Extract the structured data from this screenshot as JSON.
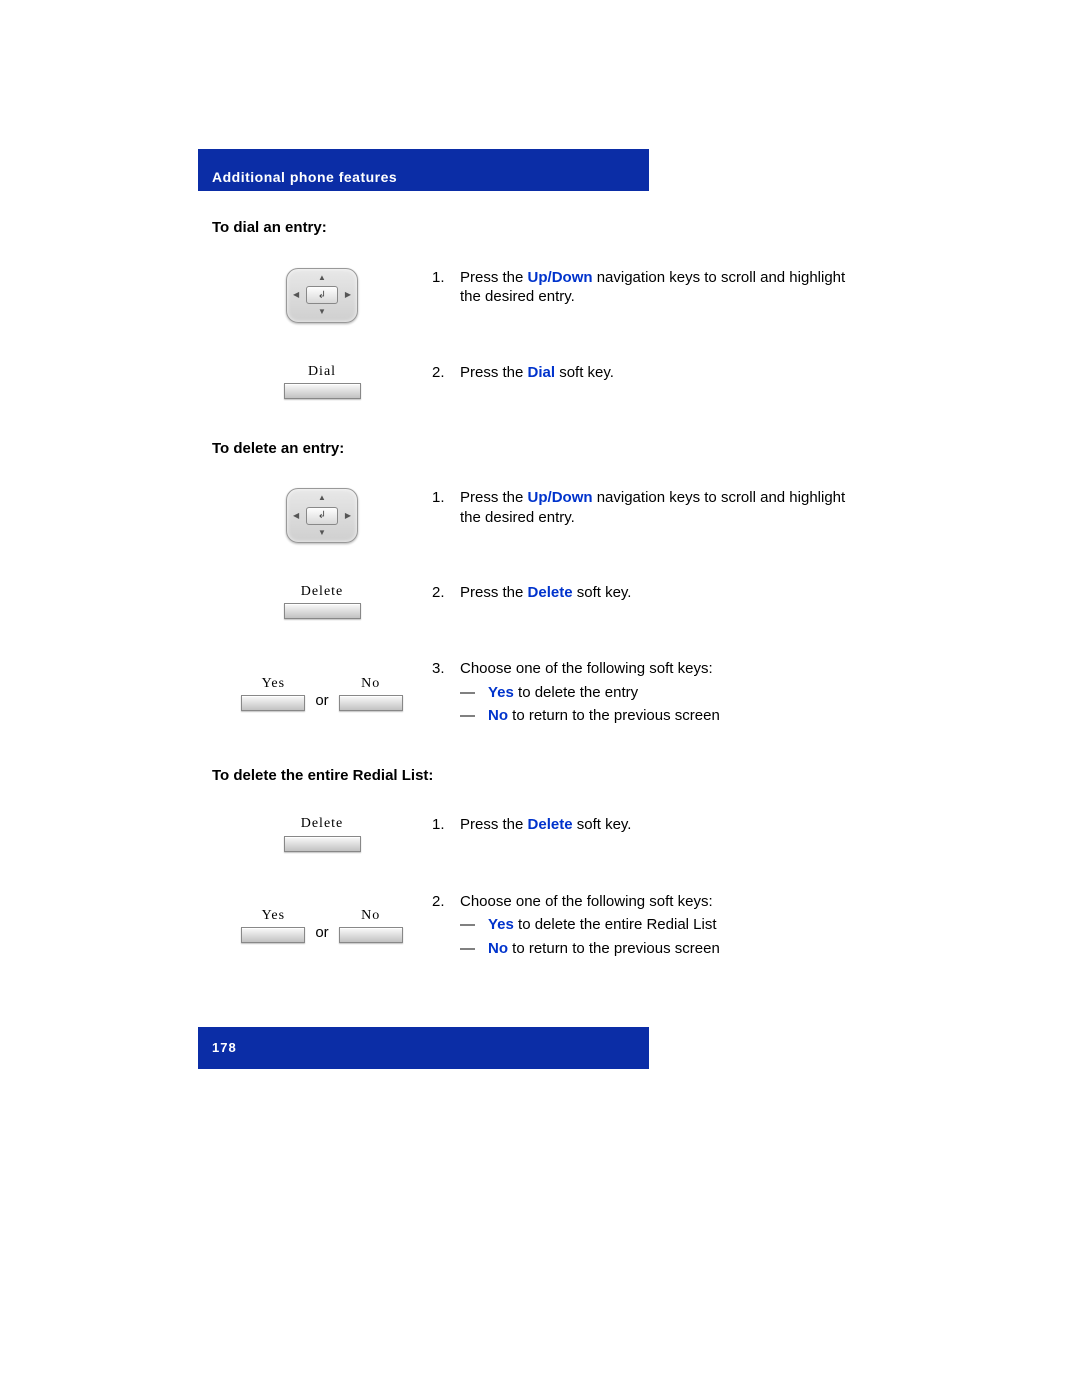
{
  "header": {
    "title": "Additional phone features"
  },
  "sections": {
    "dial": {
      "heading": "To dial an entry:",
      "step1": {
        "num": "1.",
        "pre": "Press the ",
        "key": "Up/Down",
        "post": " navigation keys to scroll and highlight the desired entry."
      },
      "step2": {
        "num": "2.",
        "pre": "Press the ",
        "key": "Dial",
        "post": " soft key."
      },
      "softkey": "Dial"
    },
    "delete": {
      "heading": "To delete an entry:",
      "step1": {
        "num": "1.",
        "pre": "Press the ",
        "key": "Up/Down",
        "post": " navigation keys to scroll and highlight the desired entry."
      },
      "step2": {
        "num": "2.",
        "pre": "Press the ",
        "key": "Delete",
        "post": " soft key."
      },
      "softkey": "Delete",
      "step3": {
        "num": "3.",
        "text": "Choose one of the following soft keys:"
      },
      "opt1": {
        "dash": "—",
        "key": "Yes",
        "post": " to delete the entry"
      },
      "opt2": {
        "dash": "—",
        "key": "No",
        "post": " to return to the previous screen"
      },
      "yesLabel": "Yes",
      "noLabel": "No",
      "or": "or"
    },
    "deleteAll": {
      "heading": "To delete the entire Redial List:",
      "step1": {
        "num": "1.",
        "pre": "Press the ",
        "key": "Delete",
        "post": " soft key."
      },
      "softkey": "Delete",
      "step2": {
        "num": "2.",
        "text": "Choose one of the following soft keys:"
      },
      "opt1": {
        "dash": "—",
        "key": "Yes",
        "post": " to delete the entire Redial List"
      },
      "opt2": {
        "dash": "—",
        "key": "No",
        "post": " to return to the previous screen"
      },
      "yesLabel": "Yes",
      "noLabel": "No",
      "or": "or"
    }
  },
  "footer": {
    "pageNumber": "178"
  }
}
